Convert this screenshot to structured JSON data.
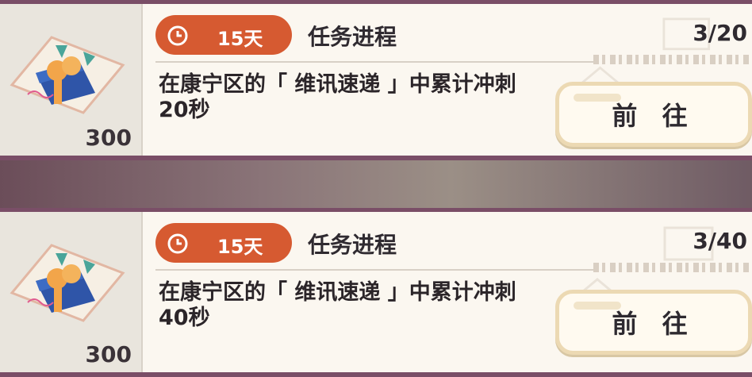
{
  "tasks": [
    {
      "reward": {
        "icon": "gift-box-icon",
        "count": "300"
      },
      "timer": {
        "icon": "clock-icon",
        "label": "15天"
      },
      "title": "任务进程",
      "progress": "3/20",
      "description": "在康宁区的「 维讯速递 」中累计冲刺20秒",
      "button": "前 往"
    },
    {
      "reward": {
        "icon": "gift-box-icon",
        "count": "300"
      },
      "timer": {
        "icon": "clock-icon",
        "label": "15天"
      },
      "title": "任务进程",
      "progress": "3/40",
      "description": "在康宁区的「 维讯速递 」中累计冲刺40秒",
      "button": "前 往"
    }
  ],
  "colors": {
    "accent": "#d65a31",
    "frame": "#7a4e67",
    "card_bg": "#fbf7f0",
    "button_border": "#ecd9b3"
  }
}
